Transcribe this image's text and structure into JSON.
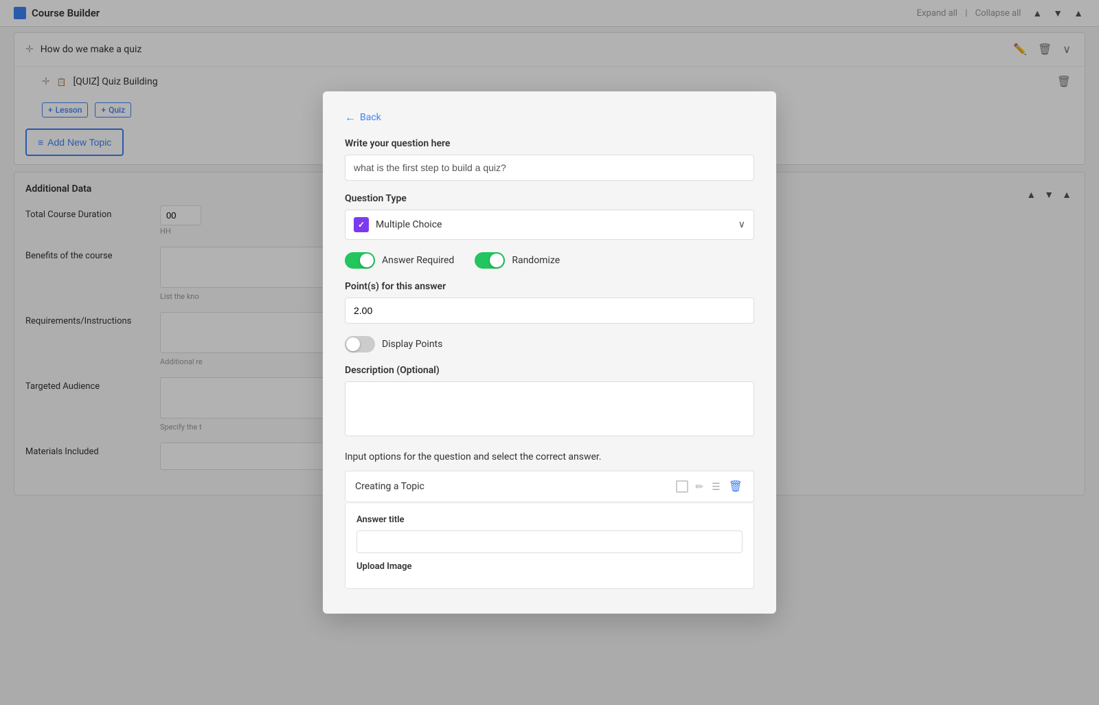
{
  "topBar": {
    "title": "Course Builder",
    "expandAll": "Expand all",
    "separator": "|",
    "collapseAll": "Collapse all"
  },
  "courseItem": {
    "title": "How do we make a quiz"
  },
  "quizItem": {
    "title": "[QUIZ] Quiz Building"
  },
  "tags": {
    "lesson": "Lesson",
    "quiz": "Quiz"
  },
  "addTopicBtn": "Add New Topic",
  "additionalData": {
    "title": "Additional Data",
    "totalCourseDuration": "Total Course Duration",
    "durationValue": "00",
    "durationUnit": "HH",
    "benefitsLabel": "Benefits of the course",
    "benefitsHint": "List the kno",
    "requirementsLabel": "Requirements/Instructions",
    "requirementsHint": "Additional re",
    "targetAudienceLabel": "Targeted Audience",
    "targetAudienceHint": "Specify the t",
    "materialsLabel": "Materials Included"
  },
  "modal": {
    "backLabel": "Back",
    "questionLabel": "Write your question here",
    "questionValue": "what is the first step to build a quiz?",
    "questionTypelabel": "Question Type",
    "questionTypeValue": "Multiple Choice",
    "answerRequiredLabel": "Answer Required",
    "answerRequiredOn": true,
    "randomizeLabel": "Randomize",
    "randomizeOn": true,
    "pointsLabel": "Point(s) for this answer",
    "pointsValue": "2.00",
    "displayPointsLabel": "Display Points",
    "displayPointsOn": false,
    "descriptionLabel": "Description (Optional)",
    "inputOptionsLabel": "Input options for the question and select the correct answer.",
    "answerOption": {
      "text": "Creating a Topic"
    },
    "expandedAnswer": {
      "titleLabel": "Answer title",
      "uploadLabel": "Upload Image"
    }
  }
}
